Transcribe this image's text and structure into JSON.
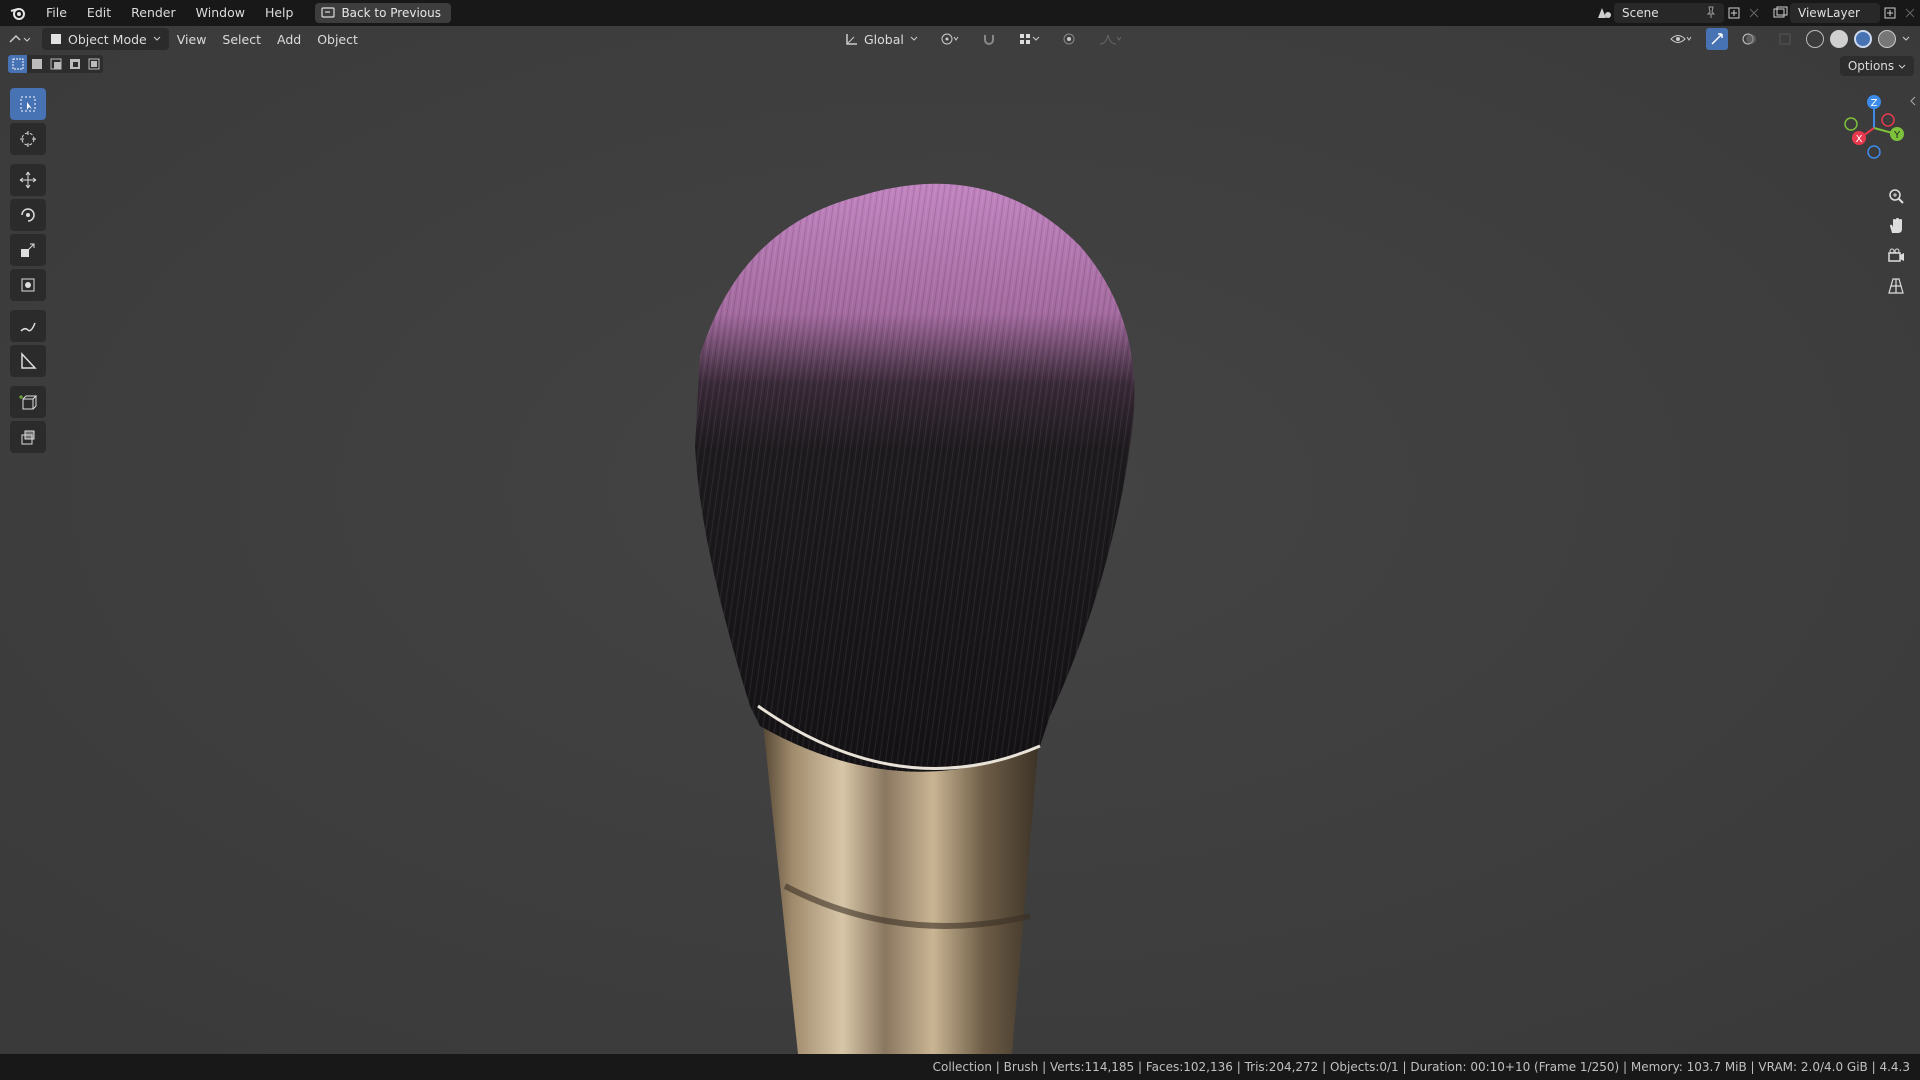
{
  "menubar": {
    "items": [
      "File",
      "Edit",
      "Render",
      "Window",
      "Help"
    ],
    "back_button": "Back to Previous"
  },
  "scene": {
    "label": "Scene"
  },
  "view_layer": {
    "label": "ViewLayer"
  },
  "viewport_header": {
    "mode": "Object Mode",
    "menus": [
      "View",
      "Select",
      "Add",
      "Object"
    ],
    "orientation": "Global",
    "options": "Options"
  },
  "gizmo": {
    "z": "Z",
    "y": "Y",
    "x": "X"
  },
  "status": {
    "text": "Collection | Brush | Verts:114,185 | Faces:102,136 | Tris:204,272 | Objects:0/1 | Duration: 00:10+10 (Frame 1/250) | Memory: 103.7 MiB | VRAM: 2.0/4.0 GiB | 4.4.3"
  },
  "colors": {
    "accent": "#4772b3",
    "viewport_bg": "#3f3f3f",
    "bristle_tip": "#b07ab0",
    "ferrule": "#b9a48a",
    "axis_x": "#e8394e",
    "axis_y": "#7ec13b",
    "axis_z": "#3d8be8"
  },
  "icons": {
    "toolbar": [
      "select-box-icon",
      "cursor-icon",
      "move-icon",
      "rotate-icon",
      "scale-icon",
      "transform-icon",
      "annotate-icon",
      "measure-icon",
      "add-cube-icon",
      "extrude-icon"
    ],
    "nav": [
      "zoom-icon",
      "pan-hand-icon",
      "camera-icon",
      "grid-perspective-icon"
    ]
  }
}
